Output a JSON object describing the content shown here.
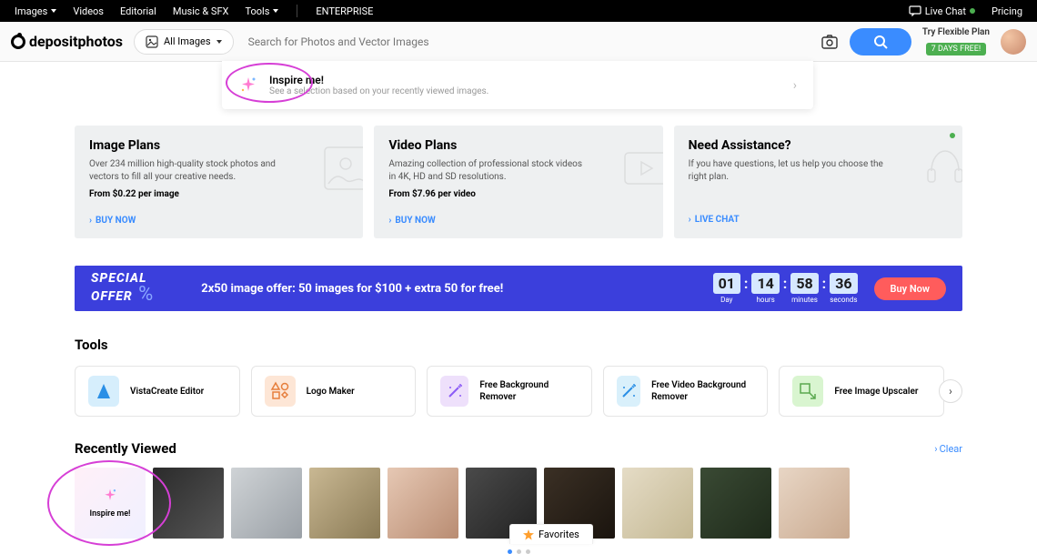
{
  "topnav": {
    "items": [
      "Images",
      "Videos",
      "Editorial",
      "Music & SFX",
      "Tools"
    ],
    "has_caret": [
      true,
      false,
      false,
      false,
      true
    ],
    "enterprise": "ENTERPRISE",
    "livechat": "Live Chat",
    "pricing": "Pricing"
  },
  "header": {
    "logo": "depositphotos",
    "category": "All Images",
    "search_placeholder": "Search for Photos and Vector Images",
    "flexible_plan": "Try Flexible Plan",
    "days_free": "7 DAYS FREE!"
  },
  "inspire": {
    "title": "Inspire me!",
    "sub": "See a selection based on your recently viewed images."
  },
  "plans": [
    {
      "title": "Image Plans",
      "desc": "Over 234 million high-quality stock photos and vectors to fill all your creative needs.",
      "price": "From $0.22 per image",
      "cta": "BUY NOW"
    },
    {
      "title": "Video Plans",
      "desc": "Amazing collection of professional stock videos in 4K, HD and SD resolutions.",
      "price": "From $7.96 per video",
      "cta": "BUY NOW"
    },
    {
      "title": "Need Assistance?",
      "desc": "If you have questions, let us help you choose the right plan.",
      "price": "",
      "cta": "LIVE CHAT"
    }
  ],
  "offer": {
    "label1": "SPECIAL",
    "label2": "OFFER",
    "text": "2x50 image offer: 50 images for $100 + extra 50 for free!",
    "countdown": {
      "days": "01",
      "hours": "14",
      "minutes": "58",
      "seconds": "36"
    },
    "cd_labels": {
      "days": "Day",
      "hours": "hours",
      "minutes": "minutes",
      "seconds": "seconds"
    },
    "buy": "Buy Now"
  },
  "tools_title": "Tools",
  "tools": [
    {
      "label": "VistaCreate Editor",
      "bg": "#d6eefc"
    },
    {
      "label": "Logo Maker",
      "bg": "#fde6d6"
    },
    {
      "label": "Free Background Remover",
      "bg": "#eee0fb"
    },
    {
      "label": "Free Video Background Remover",
      "bg": "#d9f0fb"
    },
    {
      "label": "Free Image Upscaler",
      "bg": "#d9f5d0"
    }
  ],
  "recently": {
    "title": "Recently Viewed",
    "clear": "Clear",
    "inspire_card": "Inspire me!"
  },
  "favorites": "Favorites",
  "thumb_colors": [
    "#3a3a3a",
    "#cfd3d6",
    "#b9a882",
    "#d7b9a3",
    "#3b3b3b",
    "#2b2420",
    "#d7cdb9",
    "#2e3a2c",
    "#d8c6b3"
  ]
}
